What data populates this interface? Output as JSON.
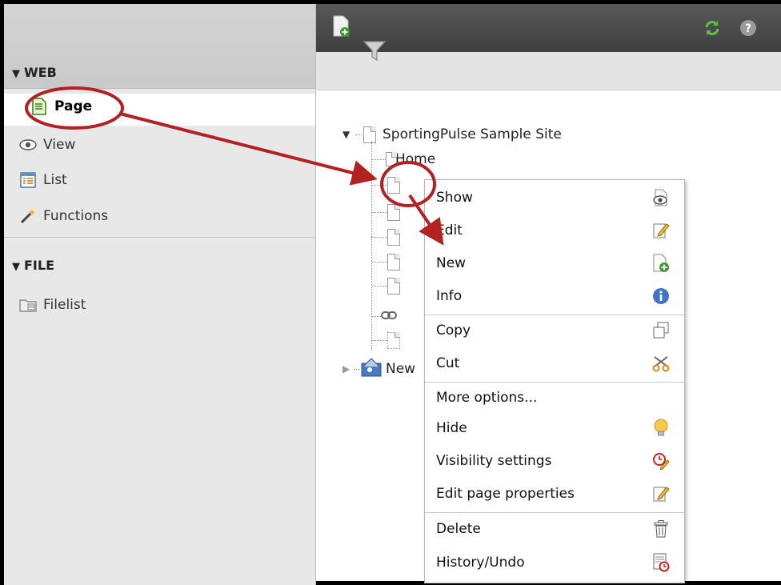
{
  "nav": {
    "web_label": "WEB",
    "file_label": "FILE",
    "items": [
      {
        "label": "Page"
      },
      {
        "label": "View"
      },
      {
        "label": "List"
      },
      {
        "label": "Functions"
      }
    ],
    "file_items": [
      {
        "label": "Filelist"
      }
    ]
  },
  "tree": {
    "root_label": "SportingPulse Sample Site",
    "home_label": "Home",
    "second_root_label": "New"
  },
  "context_menu": {
    "items": [
      {
        "label": "Show",
        "icon": "show-icon"
      },
      {
        "label": "Edit",
        "icon": "edit-icon"
      },
      {
        "label": "New",
        "icon": "new-page-icon"
      },
      {
        "label": "Info",
        "icon": "info-icon"
      },
      {
        "label": "Copy",
        "icon": "copy-icon"
      },
      {
        "label": "Cut",
        "icon": "cut-icon"
      },
      {
        "label": "More options...",
        "icon": ""
      },
      {
        "label": "Hide",
        "icon": "lightbulb-icon"
      },
      {
        "label": "Visibility settings",
        "icon": "clock-pencil-icon"
      },
      {
        "label": "Edit page properties",
        "icon": "edit-properties-icon"
      },
      {
        "label": "Delete",
        "icon": "trash-icon"
      },
      {
        "label": "History/Undo",
        "icon": "history-icon"
      }
    ]
  },
  "colors": {
    "annotation": "#b22222",
    "toolbar": "#4a4a4a",
    "nav_bg": "#e8e8e8"
  }
}
